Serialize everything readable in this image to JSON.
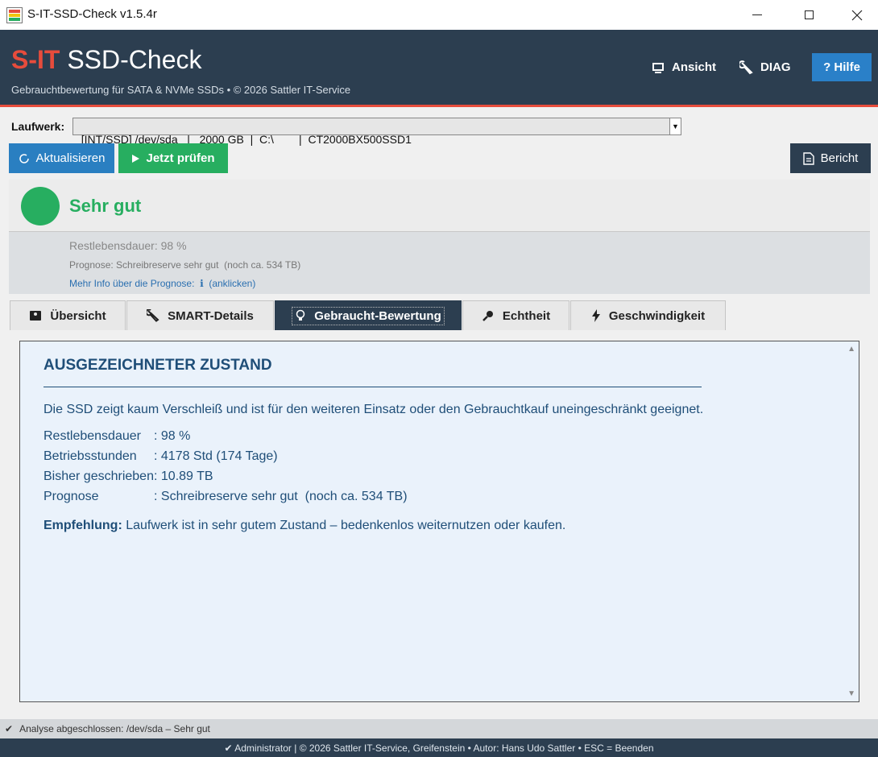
{
  "window": {
    "title": "S-IT-SSD-Check  v1.5.4r",
    "icon_label": "SSD",
    "controls": [
      "minimize",
      "maximize",
      "close"
    ]
  },
  "header": {
    "brand_red": "S-IT",
    "brand_rest": " SSD-Check",
    "subtitle": "Gebrauchtbewertung für SATA & NVMe SSDs  •  © 2026 Sattler IT-Service",
    "buttons": {
      "ansicht": "Ansicht",
      "diag": "DIAG",
      "hilfe": "? Hilfe"
    }
  },
  "drive": {
    "label": "Laufwerk:",
    "selected": "[INT/SSD] /dev/sda   |   2000 GB  |  C:\\        |  CT2000BX500SSD1"
  },
  "actions": {
    "refresh": "Aktualisieren",
    "check": "Jetzt prüfen",
    "report": "Bericht"
  },
  "status": {
    "title": "Sehr gut",
    "color": "#27ae60",
    "rest_life": "Restlebensdauer: 98 %",
    "prognosis": "Prognose: Schreibreserve sehr gut  (noch ca. 534 TB)",
    "more_info": "Mehr Info über die Prognose:  ℹ  (anklicken)"
  },
  "tabs": [
    {
      "label": "Übersicht",
      "icon": "drive-icon",
      "active": false
    },
    {
      "label": "SMART-Details",
      "icon": "wrench-icon",
      "active": false
    },
    {
      "label": "Gebraucht-Bewertung",
      "icon": "lightbulb-icon",
      "active": true
    },
    {
      "label": "Echtheit",
      "icon": "key-icon",
      "active": false
    },
    {
      "label": "Geschwindigkeit",
      "icon": "lightning-icon",
      "active": false
    }
  ],
  "content": {
    "title": "AUSGEZEICHNETER ZUSTAND",
    "description": "Die SSD zeigt kaum Verschleiß und ist für den weiteren Einsatz oder den Gebrauchtkauf uneingeschränkt geeignet.",
    "rows": [
      {
        "key": "Restlebensdauer",
        "value": ": 98 %"
      },
      {
        "key": "Betriebsstunden",
        "value": ": 4178 Std (174 Tage)"
      },
      {
        "key": "Bisher geschrieben",
        "value": ": 10.89 TB"
      },
      {
        "key": "Prognose",
        "value": ": Schreibreserve sehr gut  (noch ca. 534 TB)"
      }
    ],
    "recommendation_label": "Empfehlung:",
    "recommendation_text": " Laufwerk ist in sehr gutem Zustand – bedenkenlos weiternutzen oder kaufen."
  },
  "footer": {
    "status": "Analyse abgeschlossen: /dev/sda  –  Sehr gut",
    "info": "✔ Administrator  |  © 2026 Sattler IT-Service, Greifenstein  •  Autor: Hans Udo Sattler  •  ESC = Beenden"
  },
  "colors": {
    "header_bg": "#2c3e50",
    "accent_red": "#e74c3c",
    "button_blue": "#2a7fc1",
    "button_green": "#27ae60",
    "content_text": "#1f4e78"
  }
}
